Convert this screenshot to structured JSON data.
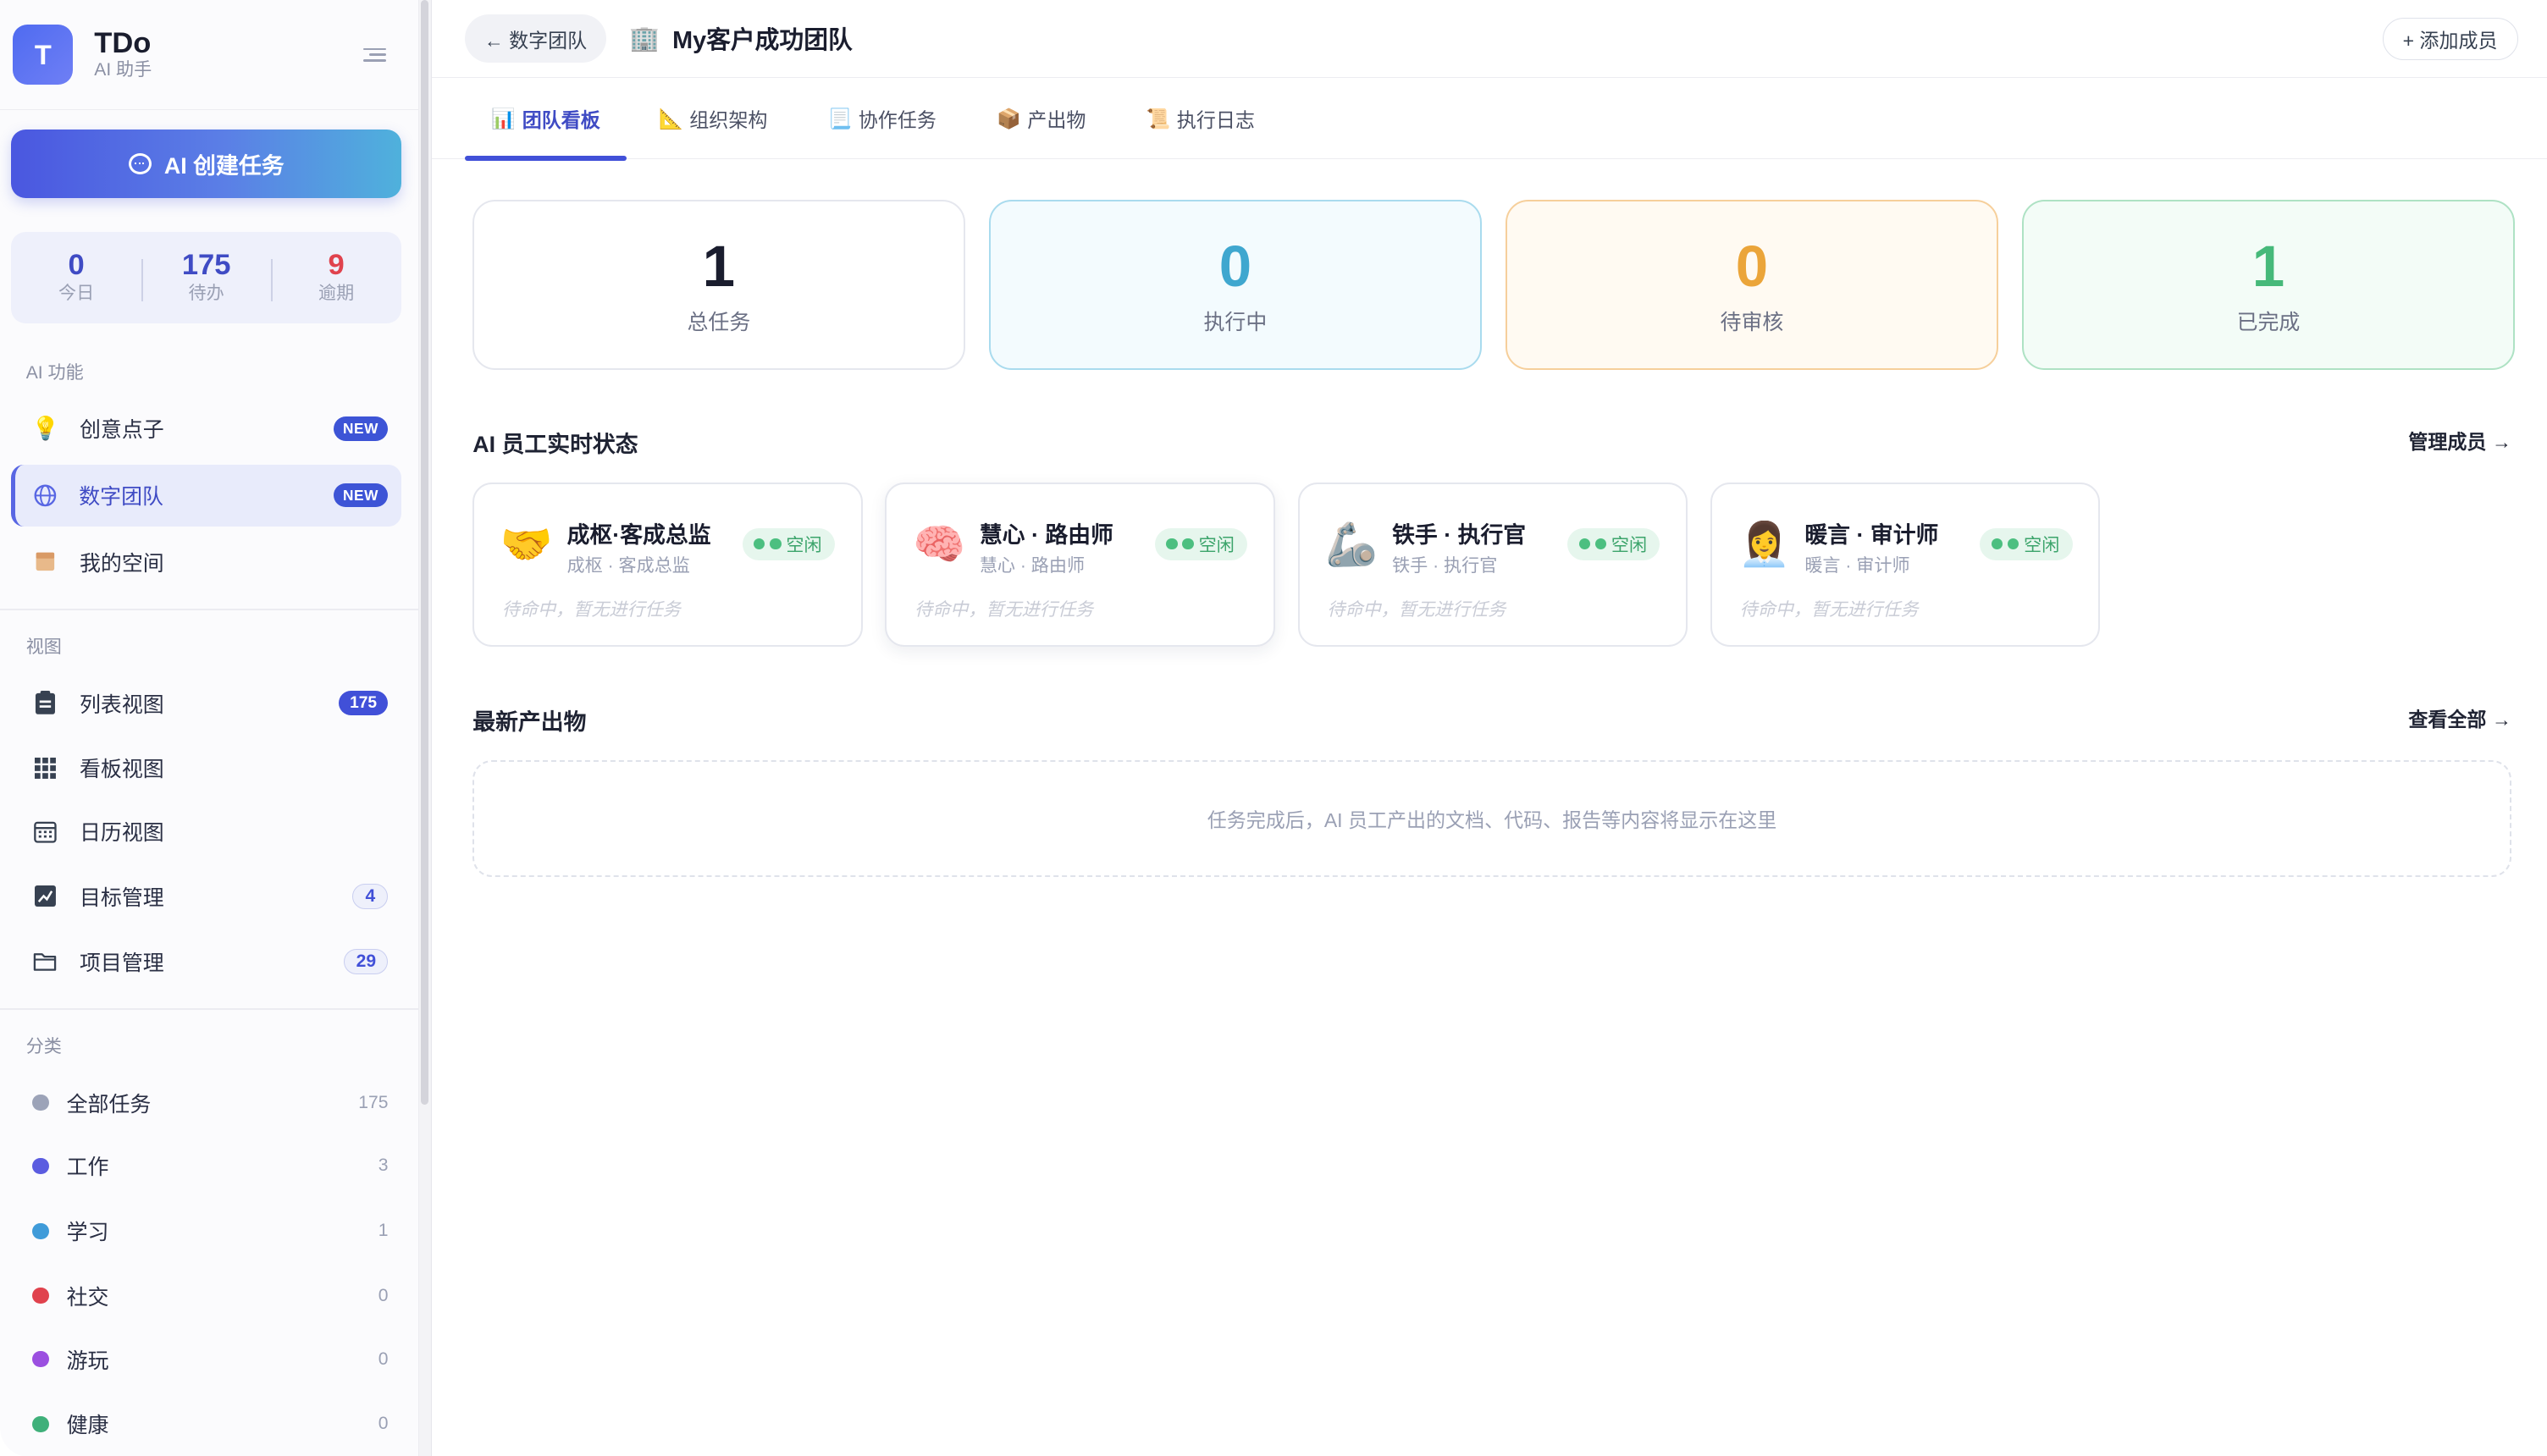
{
  "brand": {
    "logo_letter": "T",
    "name": "TDo",
    "subtitle": "AI 助手"
  },
  "ai_create_button": "AI 创建任务",
  "stats": [
    {
      "value": "0",
      "label": "今日"
    },
    {
      "value": "175",
      "label": "待办"
    },
    {
      "value": "9",
      "label": "逾期"
    }
  ],
  "sections": {
    "ai": "AI 功能",
    "views": "视图",
    "categories": "分类"
  },
  "ai_features": [
    {
      "icon": "lightbulb-icon",
      "label": "创意点子",
      "badge": "NEW"
    },
    {
      "icon": "globe-icon",
      "label": "数字团队",
      "badge": "NEW",
      "active": true
    },
    {
      "icon": "box-icon",
      "label": "我的空间"
    }
  ],
  "views": [
    {
      "icon": "clipboard-icon",
      "label": "列表视图",
      "badge": "175"
    },
    {
      "icon": "grid-icon",
      "label": "看板视图"
    },
    {
      "icon": "calendar-icon",
      "label": "日历视图"
    },
    {
      "icon": "chart-icon",
      "label": "目标管理",
      "badge": "4"
    },
    {
      "icon": "folder-icon",
      "label": "项目管理",
      "badge": "29"
    }
  ],
  "categories": [
    {
      "label": "全部任务",
      "count": "175",
      "color": "#9ca3b8"
    },
    {
      "label": "工作",
      "count": "3",
      "color": "#5b5ce0"
    },
    {
      "label": "学习",
      "count": "1",
      "color": "#3f9bd9"
    },
    {
      "label": "社交",
      "count": "0",
      "color": "#e0424d"
    },
    {
      "label": "游玩",
      "count": "0",
      "color": "#9b4fe0"
    },
    {
      "label": "健康",
      "count": "0",
      "color": "#3fb07a"
    }
  ],
  "topbar": {
    "back_label": "← 数字团队",
    "title": "My客户成功团队",
    "add_member": "+ 添加成员"
  },
  "tabs": [
    {
      "icon": "📊",
      "label": "团队看板",
      "active": true
    },
    {
      "icon": "📐",
      "label": "组织架构"
    },
    {
      "icon": "📃",
      "label": "协作任务"
    },
    {
      "icon": "📦",
      "label": "产出物"
    },
    {
      "icon": "📜",
      "label": "执行日志"
    }
  ],
  "kpis": [
    {
      "value": "1",
      "label": "总任务"
    },
    {
      "value": "0",
      "label": "执行中"
    },
    {
      "value": "0",
      "label": "待审核"
    },
    {
      "value": "1",
      "label": "已完成"
    }
  ],
  "agents_section": {
    "title": "AI 员工实时状态",
    "link": "管理成员 →"
  },
  "agents": [
    {
      "emoji": "🤝",
      "name": "成枢·客成总监",
      "role": "成枢 · 客成总监",
      "status": "空闲",
      "idle": "待命中，暂无进行任务"
    },
    {
      "emoji": "🧠",
      "name": "慧心 · 路由师",
      "role": "慧心 · 路由师",
      "status": "空闲",
      "idle": "待命中，暂无进行任务"
    },
    {
      "emoji": "🦾",
      "name": "铁手 · 执行官",
      "role": "铁手 · 执行官",
      "status": "空闲",
      "idle": "待命中，暂无进行任务"
    },
    {
      "emoji": "👩‍💼",
      "name": "暖言 · 审计师",
      "role": "暖言 · 审计师",
      "status": "空闲",
      "idle": "待命中，暂无进行任务"
    }
  ],
  "outputs_section": {
    "title": "最新产出物",
    "link": "查看全部 →",
    "empty": "任务完成后，AI 员工产出的文档、代码、报告等内容将显示在这里"
  },
  "colors": {
    "accent": "#4150d8",
    "status_idle": "#3ca46b"
  }
}
